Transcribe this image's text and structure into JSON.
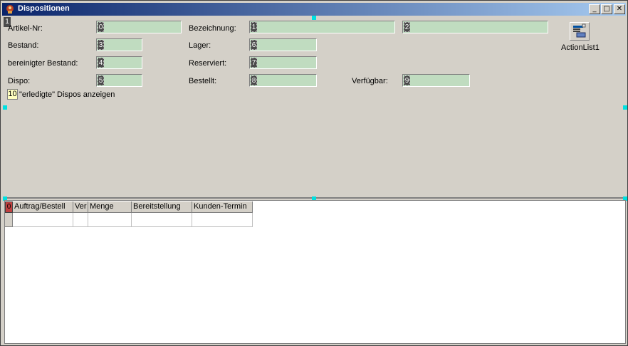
{
  "window": {
    "title": "Dispositionen",
    "controls": {
      "minimize": "_",
      "maximize": "□",
      "close": "✕"
    }
  },
  "form": {
    "artikel_label": "Artikel-Nr:",
    "artikel_idx": "0",
    "bezeichnung_label": "Bezeichnung:",
    "bezeichnung_idx": "1",
    "bezeichnung2_idx": "2",
    "bestand_label": "Bestand:",
    "bestand_idx": "3",
    "lager_label": "Lager:",
    "lager_idx": "6",
    "bereinigt_label": "bereinigter Bestand:",
    "bereinigt_idx": "4",
    "reserviert_label": "Reserviert:",
    "reserviert_idx": "7",
    "dispo_label": "Dispo:",
    "dispo_idx": "5",
    "bestellt_label": "Bestellt:",
    "bestellt_idx": "8",
    "verfuegbar_label": "Verfügbar:",
    "verfuegbar_idx": "9",
    "erledigte_idx": "10",
    "erledigte_label": "\"erledigte\" Dispos anzeigen",
    "panel_idx": "1"
  },
  "actionlist": {
    "label": "ActionList1",
    "icon": "actionlist-icon"
  },
  "grid": {
    "row_indicator": "0",
    "columns": [
      "Auftrag/Bestell",
      "Ver",
      "Menge",
      "Bereitstellung",
      "Kunden-Termin"
    ]
  },
  "colors": {
    "field_bg": "#c0dcc0",
    "titlebar_start": "#0a246a",
    "titlebar_end": "#a6caf0",
    "selection_handle": "#00e0e0"
  }
}
